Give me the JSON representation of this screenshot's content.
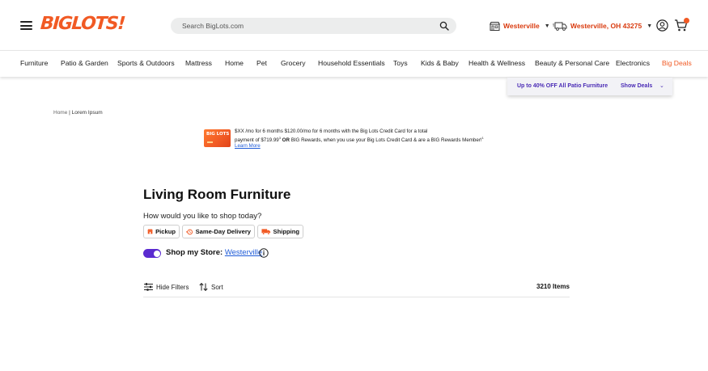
{
  "header": {
    "logo_text": "BIGLOTS!",
    "search_placeholder": "Search BigLots.com",
    "store_label": "Westerville",
    "delivery_location": "Westerville, OH 43275"
  },
  "nav": {
    "items": [
      "Furniture",
      "Patio & Garden",
      "Sports & Outdoors",
      "Mattress",
      "Home",
      "Pet",
      "Grocery",
      "Household Essentials",
      "Toys",
      "Kids & Baby",
      "Health & Wellness",
      "Beauty & Personal Care",
      "Electronics",
      "Big Deals"
    ]
  },
  "promo": {
    "text": "Up to 40% OFF All Patio Furniture",
    "link": "Show Deals"
  },
  "breadcrumb": {
    "home": "Home",
    "separator": "|",
    "current": "Lorem Ipsum"
  },
  "offer": {
    "card_logo": "BIG LOTS",
    "line1": "$XX /mo for 6 months $120.00/mo for 6 months with the Big Lots Credit Card for a total",
    "line2_a": "payment of $719.99",
    "line2_sup": "3",
    "line2_or": "OR",
    "line2_b": "BIG Rewards, when you use your Big Lots Credit Card & are a BIG Rewards Member!",
    "line2_sup2": "1",
    "learn_more": "Learn More"
  },
  "page": {
    "title": "Living Room Furniture",
    "shop_question": "How would you like to shop today?",
    "fulfillment": [
      "Pickup",
      "Same-Day Delivery",
      "Shipping"
    ],
    "shop_store_label": "Shop my Store:",
    "shop_store_link": "Westerville",
    "hide_filters": "Hide Filters",
    "sort": "Sort",
    "items_count": "3210 Items"
  },
  "colors": {
    "brand_orange": "#f15a24",
    "accent_purple": "#5b2bd0",
    "link_blue": "#1e5bd8"
  }
}
